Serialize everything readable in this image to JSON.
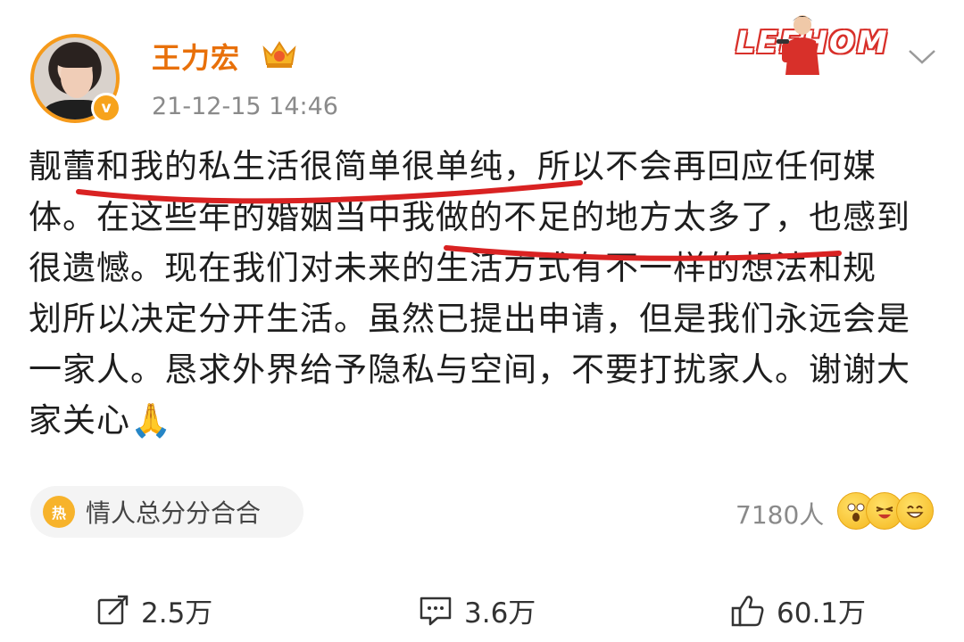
{
  "post": {
    "author": "王力宏",
    "timestamp": "21-12-15 14:46",
    "verified_mark": "v",
    "lines": [
      "靓蕾和我的私生活很简单很单纯，所以不会再回应任何媒",
      "体。在这些年的婚姻当中我做的不足的地方太多了，也感到",
      "很遗憾。现在我们对未来的生活方式有不一样的想法和规",
      "划所以决定分开生活。虽然已提出申请，但是我们永远会是",
      "一家人。恳求外界给予隐私与空间，不要打扰家人。谢谢大",
      "家关心🙏"
    ]
  },
  "decoration": {
    "banner_text": "LEEHOM"
  },
  "topic": {
    "icon_text": "热",
    "label": "情人总分分合合"
  },
  "reactions": {
    "count": "7180人",
    "emoji_icons": [
      "surprised-emoji",
      "laughing-emoji",
      "grinning-emoji"
    ]
  },
  "actions": {
    "repost": "2.5万",
    "comment": "3.6万",
    "like": "60.1万"
  },
  "colors": {
    "username": "#e8700a",
    "verified": "#f7a31c",
    "underline": "#d92222",
    "timestamp": "#8a8a8a"
  }
}
